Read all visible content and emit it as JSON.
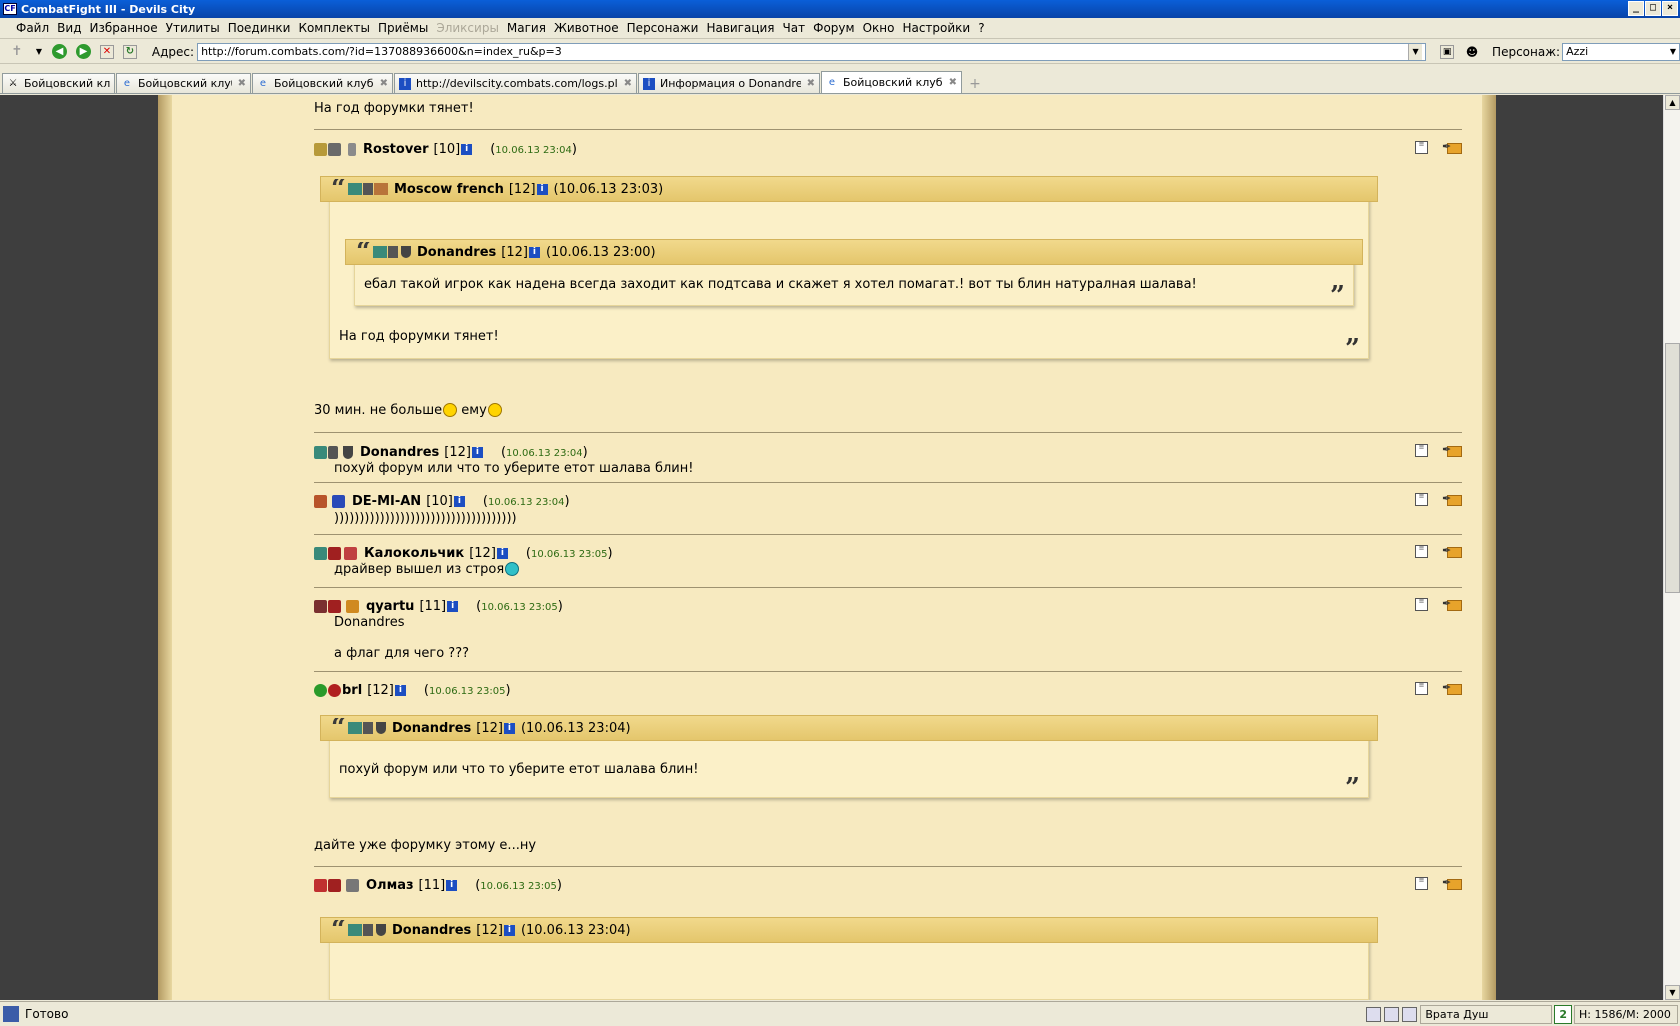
{
  "window": {
    "title": "CombatFight III - Devils City",
    "min": "_",
    "max": "□",
    "close": "×"
  },
  "menu": [
    "Файл",
    "Вид",
    "Избранное",
    "Утилиты",
    "Поединки",
    "Комплекты",
    "Приёмы",
    "Эликсиры",
    "Магия",
    "Животное",
    "Персонажи",
    "Навигация",
    "Чат",
    "Форум",
    "Окно",
    "Настройки",
    "?"
  ],
  "toolbar": {
    "address_label": "Адрес:",
    "address_value": "http://forum.combats.com/?id=137088936600&n=index_ru&p=3",
    "char_label": "Персонаж:",
    "char_value": "Azzi"
  },
  "tabs": [
    {
      "title": "Бойцовский клуб"
    },
    {
      "title": "Бойцовский клуб."
    },
    {
      "title": "Бойцовский клуб."
    },
    {
      "title": "http://devilscity.combats.com/logs.pl?l..."
    },
    {
      "title": "Информация о Donandres"
    },
    {
      "title": "Бойцовский клуб."
    }
  ],
  "posts": {
    "top_text": "На год форумки тянет!",
    "p1": {
      "user": "Rostover",
      "level": "[10]",
      "date": "10.06.13 23:04",
      "q1": {
        "user": "Moscow french",
        "level": "[12]",
        "date": "(10.06.13 23:03)",
        "q2": {
          "user": "Donandres",
          "level": "[12]",
          "date": "(10.06.13 23:00)",
          "text": "ебал такой игрок как надена всегда заходит как подтсава и скажет я хотел помагат.! вот ты блин натуралная шалава!"
        },
        "text": "На год форумки тянет!"
      },
      "text_a": "30 мин. не больше",
      "text_b": " ему"
    },
    "p2": {
      "user": "Donandres",
      "level": "[12]",
      "date": "10.06.13 23:04",
      "text": "похуй форум или что то уберите етот шалава блин!"
    },
    "p3": {
      "user": "DE-MI-AN",
      "level": "[10]",
      "date": "10.06.13 23:04",
      "text": "))))))))))))))))))))))))))))))))))))"
    },
    "p4": {
      "user": "Калокольчик",
      "level": "[12]",
      "date": "10.06.13 23:05",
      "text": "драйвер вышел из строя"
    },
    "p5": {
      "user": "qyartu",
      "level": "[11]",
      "date": "10.06.13 23:05",
      "text1": "Donandres",
      "text2": "а флаг для чего ???"
    },
    "p6": {
      "user": "brl",
      "level": "[12]",
      "date": "10.06.13 23:05",
      "q1": {
        "user": "Donandres",
        "level": "[12]",
        "date": "(10.06.13 23:04)",
        "text": "похуй форум или что то уберите етот шалава блин!"
      },
      "text": "дайте уже форумку этому е...ну"
    },
    "p7": {
      "user": "Олмаз",
      "level": "[11]",
      "date": "10.06.13 23:05",
      "q1": {
        "user": "Donandres",
        "level": "[12]",
        "date": "(10.06.13 23:04)"
      }
    }
  },
  "status": {
    "text": "Готово",
    "location": "Врата Душ",
    "hp": "Н: 1586/М: 2000",
    "num": "2"
  },
  "icons": {
    "info": "i",
    "quote_open": "“",
    "quote_close": "”"
  }
}
